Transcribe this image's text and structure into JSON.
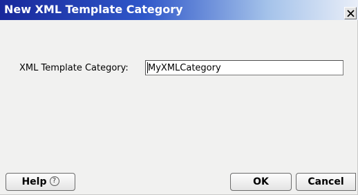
{
  "dialog": {
    "title": "New XML Template Category",
    "close_icon": "close-icon"
  },
  "form": {
    "label": "XML Template Category:",
    "value": "MyXMLCategory"
  },
  "buttons": {
    "help_label": "Help",
    "help_icon": "question-mark-icon",
    "help_glyph": "?",
    "ok_label": "OK",
    "cancel_label": "Cancel"
  },
  "colors": {
    "titlebar_start": "#18289b",
    "titlebar_end": "#e9eef8",
    "dialog_background": "#f1f1f0"
  }
}
